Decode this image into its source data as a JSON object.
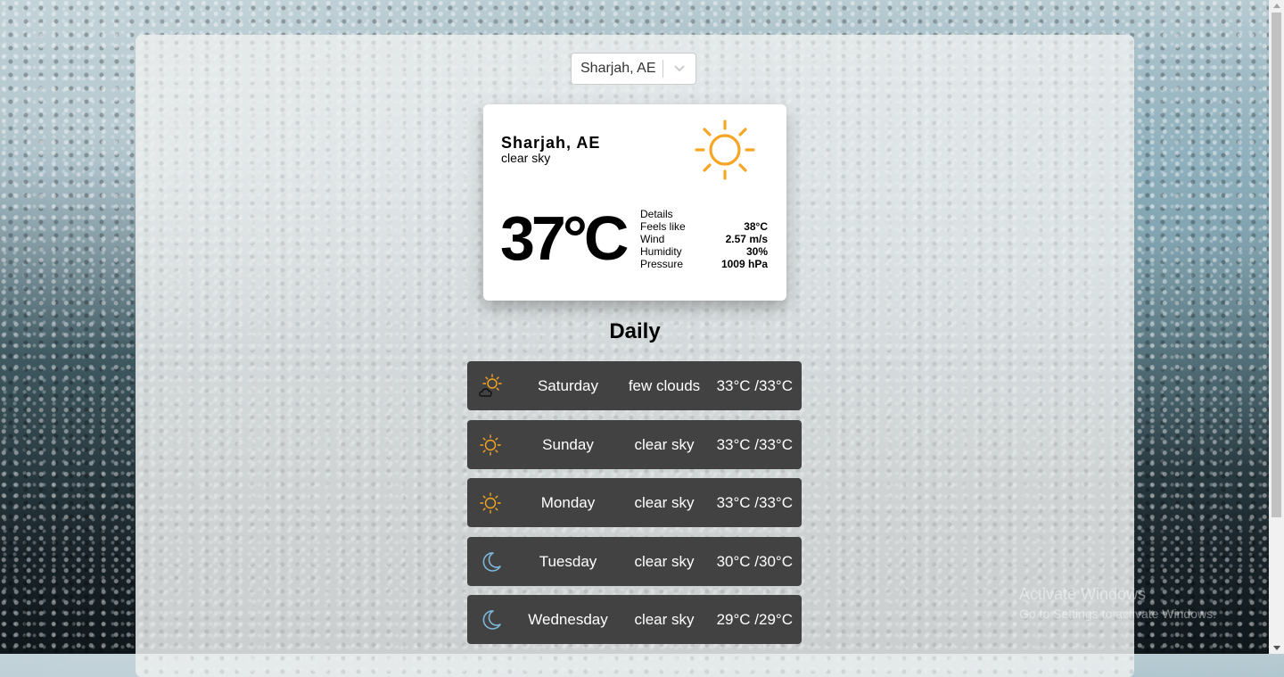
{
  "location_select": {
    "value": "Sharjah, AE"
  },
  "current": {
    "city": "Sharjah, AE",
    "description": "clear sky",
    "icon": "sun-icon",
    "temperature": "37°C",
    "details_label": "Details",
    "details": [
      {
        "label": "Feels like",
        "value": "38°C"
      },
      {
        "label": "Wind",
        "value": "2.57 m/s"
      },
      {
        "label": "Humidity",
        "value": "30%"
      },
      {
        "label": "Pressure",
        "value": "1009 hPa"
      }
    ]
  },
  "daily": {
    "title": "Daily",
    "items": [
      {
        "day": "Saturday",
        "description": "few clouds",
        "temp": "33°C /33°C",
        "icon": "sun-cloud-icon"
      },
      {
        "day": "Sunday",
        "description": "clear sky",
        "temp": "33°C /33°C",
        "icon": "sun-icon"
      },
      {
        "day": "Monday",
        "description": "clear sky",
        "temp": "33°C /33°C",
        "icon": "sun-icon"
      },
      {
        "day": "Tuesday",
        "description": "clear sky",
        "temp": "30°C /30°C",
        "icon": "moon-icon"
      },
      {
        "day": "Wednesday",
        "description": "clear sky",
        "temp": "29°C /29°C",
        "icon": "moon-icon"
      }
    ]
  },
  "watermark": {
    "line1": "Activate Windows",
    "line2": "Go to Settings to activate Windows."
  },
  "colors": {
    "sun": "#f6a623",
    "moon": "#7db6d8",
    "day_row_bg": "#424242"
  }
}
